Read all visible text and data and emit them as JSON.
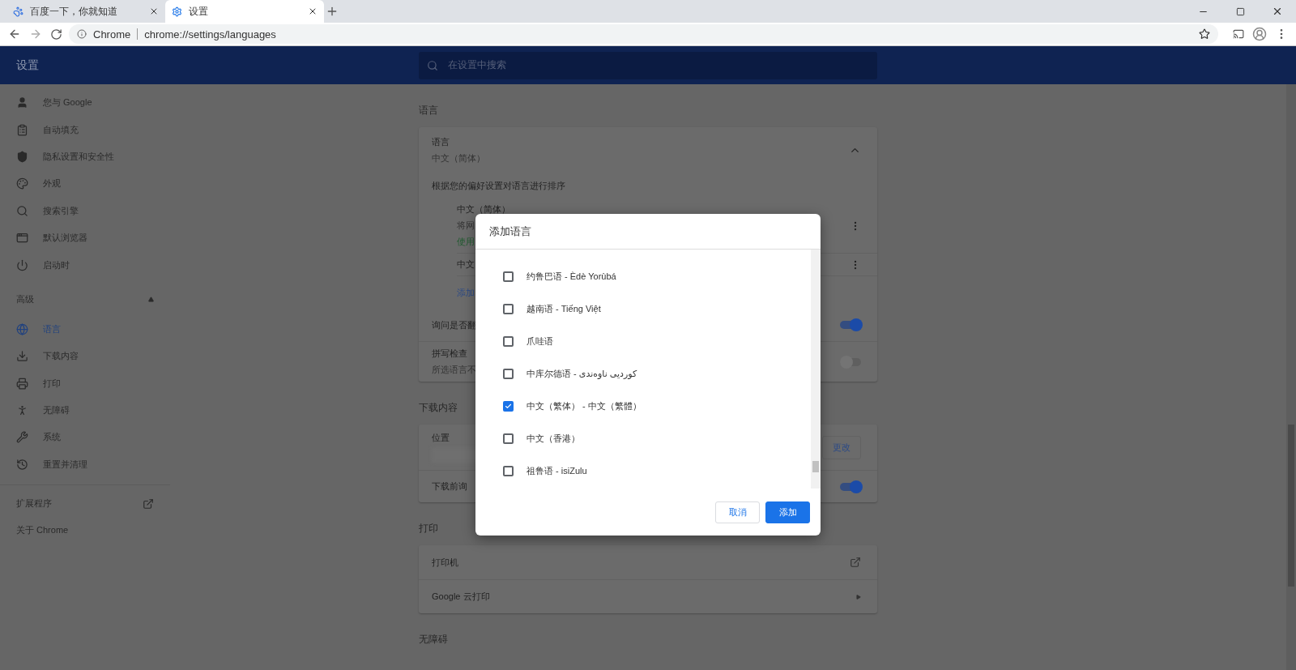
{
  "browser": {
    "tabs": [
      {
        "title": "百度一下，你就知道",
        "selected": false
      },
      {
        "title": "设置",
        "selected": true
      }
    ],
    "address": {
      "site_label": "Chrome",
      "url": "chrome://settings/languages"
    }
  },
  "header": {
    "title": "设置",
    "search": {
      "placeholder": "在设置中搜索"
    }
  },
  "sidebar": {
    "items": [
      {
        "label": "您与 Google",
        "selected": false
      },
      {
        "label": "自动填充",
        "selected": false
      },
      {
        "label": "隐私设置和安全性",
        "selected": false
      },
      {
        "label": "外观",
        "selected": false
      },
      {
        "label": "搜索引擎",
        "selected": false
      },
      {
        "label": "默认浏览器",
        "selected": false
      },
      {
        "label": "启动时",
        "selected": false
      }
    ],
    "advanced": {
      "label": "高级",
      "expanded": true
    },
    "advanced_items": [
      {
        "label": "语言",
        "selected": true
      },
      {
        "label": "下载内容",
        "selected": false
      },
      {
        "label": "打印",
        "selected": false
      },
      {
        "label": "无障碍",
        "selected": false
      },
      {
        "label": "系统",
        "selected": false
      },
      {
        "label": "重置并清理",
        "selected": false
      }
    ],
    "footer": [
      {
        "label": "扩展程序",
        "external": true
      },
      {
        "label": "关于 Chrome",
        "external": false
      }
    ]
  },
  "languages": {
    "section_title": "语言",
    "card_title": "语言",
    "card_subtitle": "中文（简体）",
    "expanded": true,
    "order_hint": "根据您的偏好设置对语言进行排序",
    "list": [
      {
        "name": "中文（简体）",
        "lines": [
          {
            "text": "将网",
            "kind": "note"
          },
          {
            "text": "使用",
            "kind": "status"
          }
        ]
      },
      {
        "name": "中文"
      }
    ],
    "add_link": "添加",
    "rows": [
      {
        "label": "询问是否翻",
        "sublabel": null,
        "on": true
      },
      {
        "label": "拼写检查",
        "sublabel": "所选语言不",
        "on": false
      }
    ]
  },
  "downloads": {
    "section_title": "下载内容",
    "location_label": "位置",
    "change_button": "更改",
    "ask_label": "下载前询",
    "ask_on": true
  },
  "printing": {
    "section_title": "打印",
    "rows": [
      {
        "label": "打印机",
        "kind": "external"
      },
      {
        "label": "Google 云打印",
        "kind": "submenu"
      }
    ]
  },
  "accessibility": {
    "section_title": "无障碍"
  },
  "dialog": {
    "title": "添加语言",
    "options": [
      {
        "label": "约鲁巴语 - Èdè Yorùbá",
        "checked": false
      },
      {
        "label": "越南语 - Tiếng Việt",
        "checked": false
      },
      {
        "label": "爪哇语",
        "checked": false
      },
      {
        "label": "中库尔德语 - کوردیی ناوەندی",
        "checked": false
      },
      {
        "label": "中文（繁体） - 中文（繁體）",
        "checked": true
      },
      {
        "label": "中文（香港）",
        "checked": false
      },
      {
        "label": "祖鲁语 - isiZulu",
        "checked": false
      }
    ],
    "cancel": "取消",
    "confirm": "添加"
  }
}
